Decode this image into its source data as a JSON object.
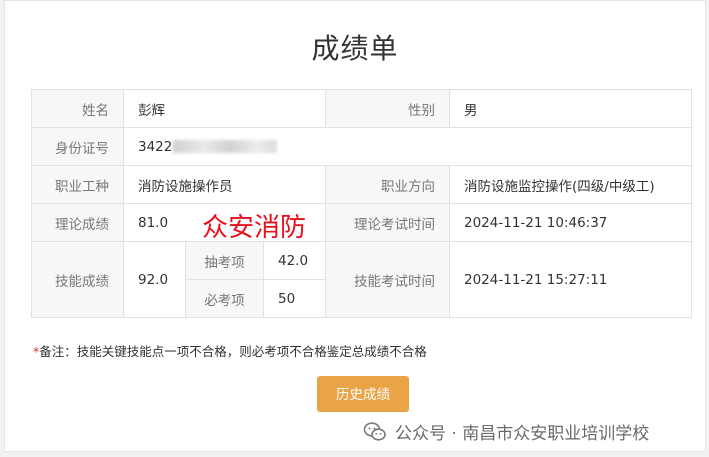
{
  "page": {
    "title": "成绩单"
  },
  "labels": {
    "name": "姓名",
    "gender": "性别",
    "id_number": "身份证号",
    "job_type": "职业工种",
    "job_direction": "职业方向",
    "theory_score": "理论成绩",
    "theory_time": "理论考试时间",
    "skill_score": "技能成绩",
    "skill_time": "技能考试时间",
    "random_items": "抽考项",
    "required_items": "必考项"
  },
  "values": {
    "name": "彭辉",
    "gender": "男",
    "id_number_visible": "3422",
    "job_type": "消防设施操作员",
    "job_direction": "消防设施监控操作(四级/中级工)",
    "theory_score": "81.0",
    "theory_time": "2024-11-21 10:46:37",
    "skill_score": "92.0",
    "skill_time": "2024-11-21 15:27:11",
    "random_items": "42.0",
    "required_items": "50"
  },
  "overlay": {
    "watermark_red": "众安消防"
  },
  "note": {
    "star": "*",
    "text": "备注：技能关键技能点一项不合格，则必考项不合格鉴定总成绩不合格"
  },
  "actions": {
    "history_button": "历史成绩"
  },
  "footer": {
    "watermark": "公众号 · 南昌市众安职业培训学校"
  },
  "colors": {
    "button": "#e9a447",
    "skill_score": "#3a8ee6",
    "watermark_red": "#e8101c"
  }
}
